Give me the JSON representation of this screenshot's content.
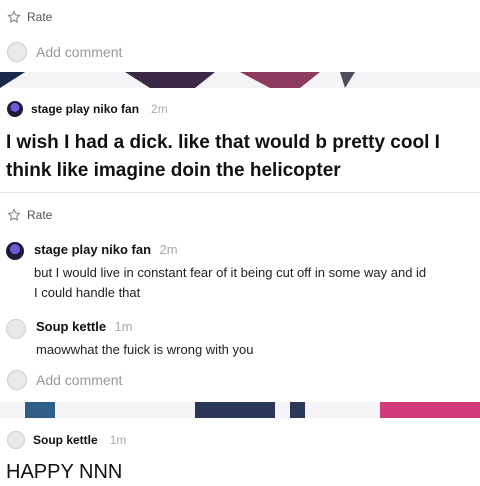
{
  "rate_label": "Rate",
  "add_comment_placeholder": "Add comment",
  "post1": {
    "author": "stage play niko fan",
    "time": "2m",
    "text": "I wish I had a dick. like that would b pretty cool I think like imagine doin the helicopter"
  },
  "comments": [
    {
      "author": "stage play niko fan",
      "time": "2m",
      "text_line1": "but I would live in constant fear of it being cut off in some way and id",
      "text_line2": "I could handle that"
    },
    {
      "author": "Soup kettle",
      "time": "1m",
      "text_line1": "maowwhat the fuick is wrong with you",
      "text_line2": ""
    }
  ],
  "post2": {
    "author": "Soup kettle",
    "time": "1m",
    "text": "HAPPY NNN"
  },
  "colors": {
    "accent_pink": "#d23a7a",
    "navy": "#1b2a4a"
  }
}
